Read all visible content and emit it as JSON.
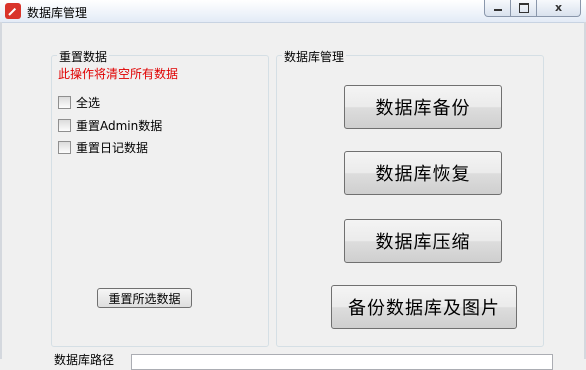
{
  "window": {
    "title": "数据库管理",
    "min_label": "",
    "max_label": "",
    "close_label": "x"
  },
  "reset_group": {
    "title": "重置数据",
    "warning": "此操作将清空所有数据",
    "warning_color": "#e00000",
    "options": [
      {
        "label": "全选",
        "checked": false
      },
      {
        "label": "重置Admin数据",
        "checked": false
      },
      {
        "label": "重置日记数据",
        "checked": false
      }
    ],
    "reset_button": "重置所选数据"
  },
  "db_group": {
    "title": "数据库管理",
    "buttons": [
      "数据库备份",
      "数据库恢复",
      "数据库压缩",
      "备份数据库及图片"
    ]
  },
  "bottom": {
    "path_label": "数据库路径"
  }
}
